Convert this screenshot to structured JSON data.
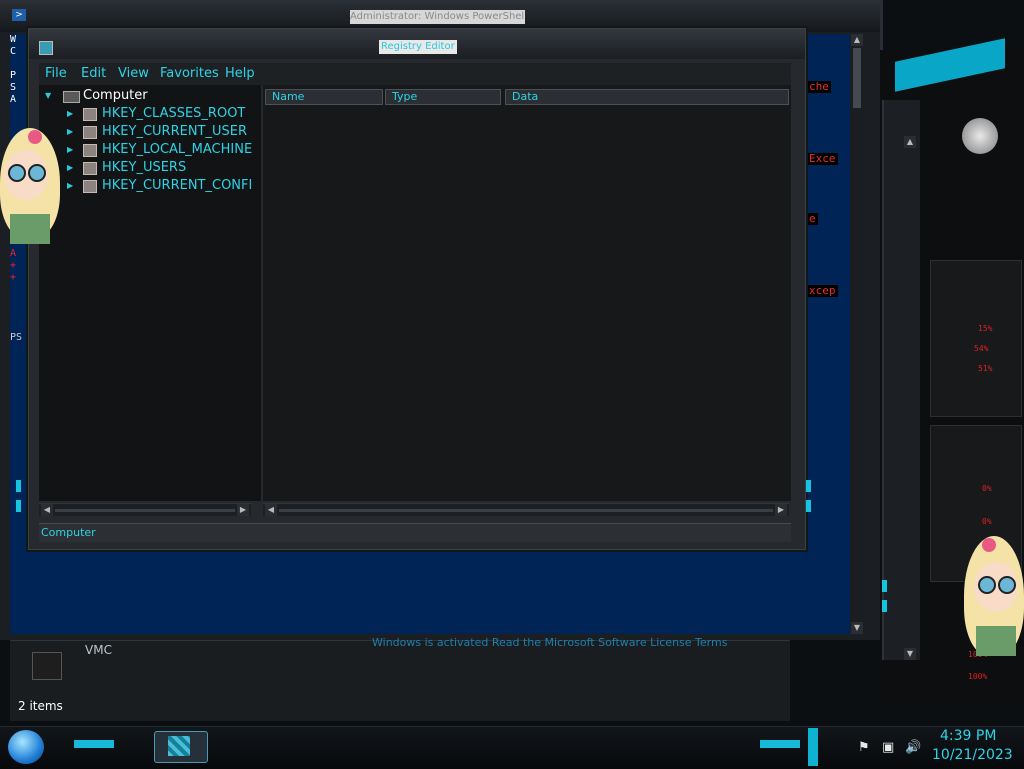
{
  "powershell": {
    "title": "Administrator: Windows PowerShell",
    "left_col_text": "W\nC\n\nP\nS\nA",
    "chunks": [
      "che",
      "Exce",
      "e",
      "xcep"
    ],
    "left_col_text_bottom": "A\n+\n+",
    "left_col_ps": "PS"
  },
  "regedit": {
    "title": "Registry Editor",
    "menu": [
      "File",
      "Edit",
      "View",
      "Favorites",
      "Help"
    ],
    "tree": {
      "root": "Computer",
      "keys": [
        "HKEY_CLASSES_ROOT",
        "HKEY_CURRENT_USER",
        "HKEY_LOCAL_MACHINE",
        "HKEY_USERS",
        "HKEY_CURRENT_CONFI"
      ]
    },
    "columns": [
      "Name",
      "Type",
      "Data"
    ],
    "status": "Computer"
  },
  "explorer": {
    "label": "VMC",
    "activation_text": "Windows is activated   Read the Microsoft Software License Terms",
    "items_count": "2 items"
  },
  "gadget": {
    "readouts": [
      "15%",
      "54%",
      "51%",
      "0%",
      "0%",
      "100%",
      "100%"
    ]
  },
  "taskbar": {
    "time": "4:39 PM",
    "date": "10/21/2023",
    "tray_icons": [
      "flag-icon",
      "network-icon",
      "volume-icon"
    ]
  },
  "colors": {
    "accent": "#2ed3e6",
    "ps_background": "#012456",
    "alert": "#e03030"
  }
}
